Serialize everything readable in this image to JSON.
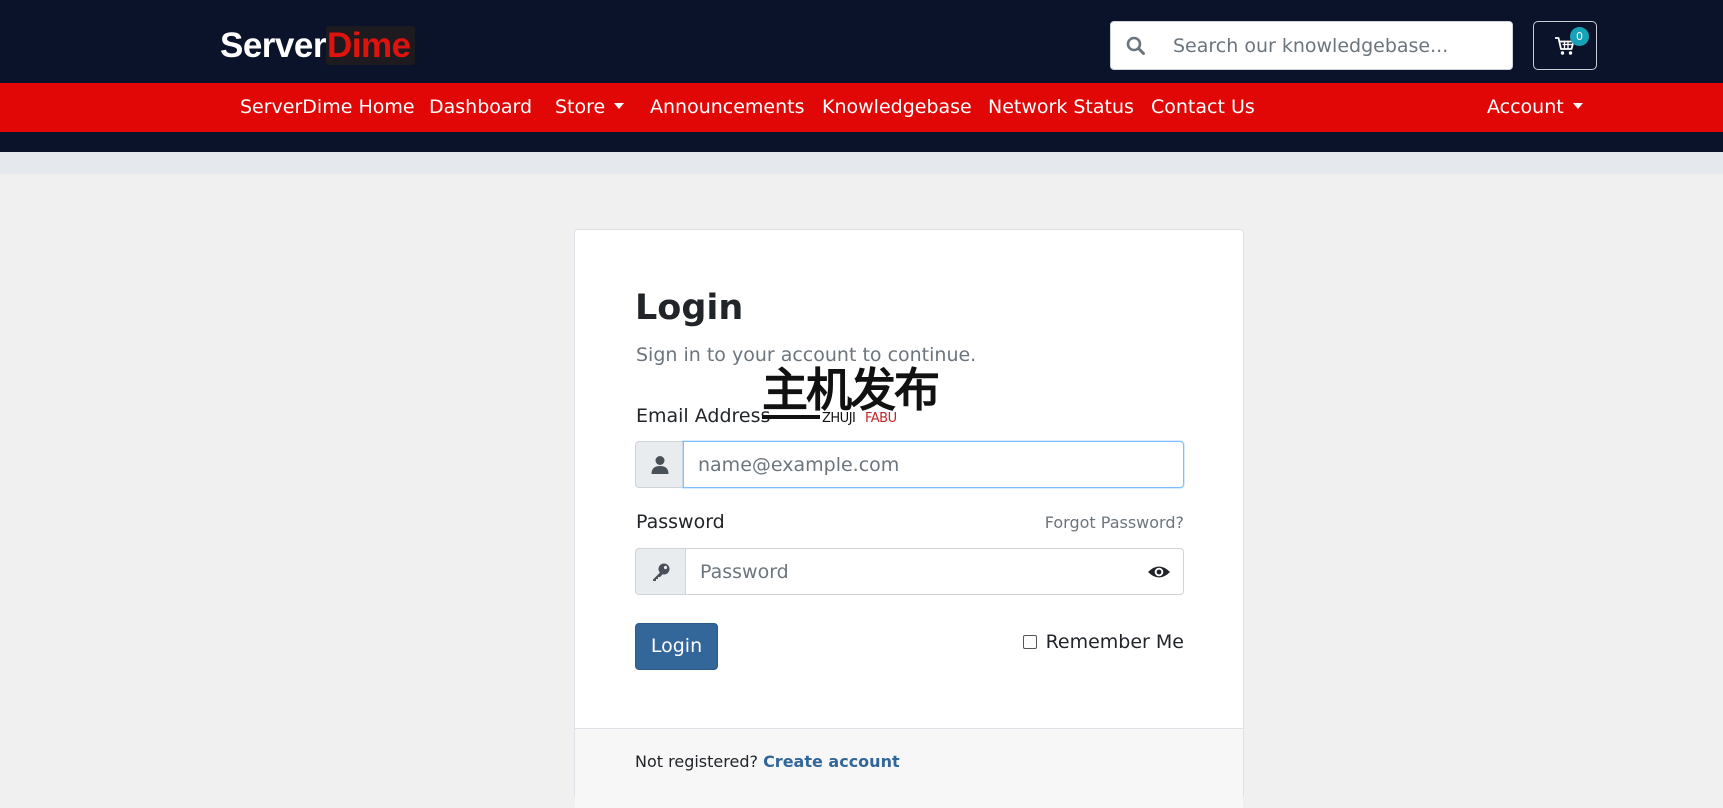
{
  "header": {
    "logo_part1": "Server",
    "logo_part2": "Dime",
    "search_placeholder": "Search our knowledgebase...",
    "cart_count": "0",
    "icons": {
      "search": "search-icon",
      "cart": "shopping-cart-icon"
    }
  },
  "nav": {
    "items": [
      {
        "label": "ServerDime Home"
      },
      {
        "label": "Dashboard"
      },
      {
        "label": "Store"
      },
      {
        "label": "Announcements"
      },
      {
        "label": "Knowledgebase"
      },
      {
        "label": "Network Status"
      },
      {
        "label": "Contact Us"
      }
    ],
    "account_label": "Account"
  },
  "login": {
    "title": "Login",
    "subtitle": "Sign in to your account to continue.",
    "email_label": "Email Address",
    "email_placeholder": "name@example.com",
    "password_label": "Password",
    "forgot_label": "Forgot Password?",
    "password_placeholder": "Password",
    "button_label": "Login",
    "remember_label": "Remember Me",
    "not_registered": "Not registered?",
    "create_account": "Create account",
    "icons": {
      "email": "user-icon",
      "password": "key-icon",
      "toggle": "eye-icon"
    }
  },
  "watermark": {
    "chinese": "主机发布",
    "latin_a": "ZHUJI",
    "latin_b": "FABU"
  },
  "colors": {
    "header_bg": "#0b132b",
    "nav_bg": "#e00706",
    "brand_red": "#e0120d",
    "button_blue": "#336699",
    "badge": "#17a2b8"
  }
}
